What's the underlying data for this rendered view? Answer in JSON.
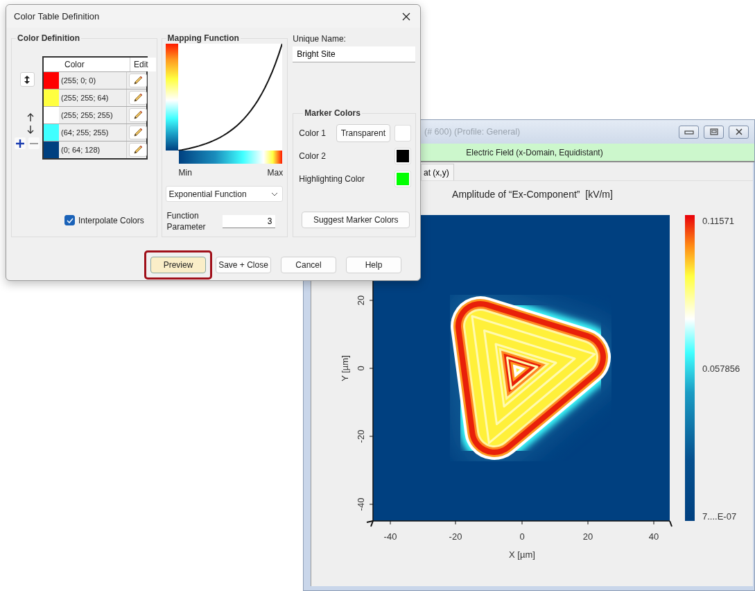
{
  "dialog": {
    "title": "Color Table Definition",
    "color_definition": {
      "title": "Color Definition",
      "columns": [
        "Color",
        "Edit"
      ],
      "rows": [
        {
          "color": "#ff0000",
          "value": "(255; 0; 0)"
        },
        {
          "color": "#ffff40",
          "value": "(255; 255; 64)"
        },
        {
          "color": "#ffffff",
          "value": "(255; 255; 255)"
        },
        {
          "color": "#40ffff",
          "value": "(64; 255; 255)"
        },
        {
          "color": "#004080",
          "value": "(0; 64; 128)"
        }
      ],
      "interpolate_colors": {
        "label": "Interpolate Colors",
        "checked": true
      }
    },
    "mapping_function": {
      "title": "Mapping Function",
      "min_label": "Min",
      "max_label": "Max",
      "function": "Exponential Function",
      "parameter_label": "Function Parameter",
      "parameter_value": "3"
    },
    "unique_name": {
      "label": "Unique Name:",
      "value": "Bright Site"
    },
    "marker_colors": {
      "title": "Marker Colors",
      "items": [
        {
          "label": "Color 1",
          "button": "Transparent",
          "color": "#ffffff"
        },
        {
          "label": "Color 2",
          "color": "#000000"
        },
        {
          "label": "Highlighting Color",
          "color": "#00ff00"
        }
      ],
      "suggest_button": "Suggest Marker Colors"
    },
    "buttons": [
      {
        "label": "Preview",
        "highlighted": true
      },
      {
        "label": "Save + Close",
        "highlighted": false
      },
      {
        "label": "Cancel",
        "highlighted": false
      },
      {
        "label": "Help",
        "highlighted": false
      }
    ]
  },
  "plot_window": {
    "title": "(# 600) (Profile: General)",
    "banner": "Electric Field (x-Domain, Equidistant)",
    "tab": "at (x,y)",
    "chart_title": "Amplitude of “Ex-Component”  [kV/m]",
    "x_axis": {
      "label": "X [µm]",
      "ticks": [
        "-40",
        "-20",
        "0",
        "20",
        "40"
      ]
    },
    "y_axis": {
      "label": "Y [µm]",
      "ticks": [
        "20",
        "0",
        "-20",
        "-40"
      ]
    },
    "colorbar": {
      "labels": [
        "0.11571",
        "0.057856",
        "7....E-07"
      ]
    }
  }
}
